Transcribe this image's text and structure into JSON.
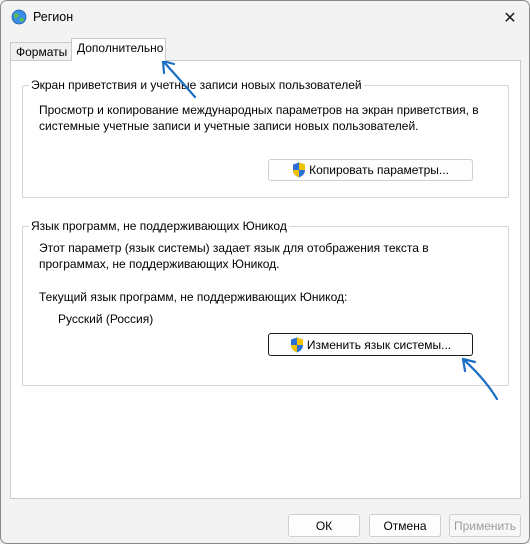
{
  "window": {
    "title": "Регион",
    "close_symbol": "✕"
  },
  "tabs": [
    {
      "label": "Форматы",
      "active": false
    },
    {
      "label": "Дополнительно",
      "active": true
    }
  ],
  "welcome_group": {
    "title": "Экран приветствия и учетные записи новых пользователей",
    "desc_line1": "Просмотр и копирование международных параметров на экран приветствия, в",
    "desc_line2": "системные учетные записи и учетные записи новых пользователей.",
    "copy_button_label": "Копировать параметры..."
  },
  "unicode_group": {
    "title": "Язык программ, не поддерживающих Юникод",
    "desc_line1": "Этот параметр (язык системы) задает язык для отображения текста в",
    "desc_line2": "программах, не поддерживающих Юникод.",
    "current_label": "Текущий язык программ, не поддерживающих Юникод:",
    "current_value": "Русский (Россия)",
    "change_button_label": "Изменить язык системы..."
  },
  "footer": {
    "ok_label": "ОК",
    "cancel_label": "Отмена",
    "apply_label": "Применить"
  },
  "colors": {
    "accent_arrow": "#1a6fc4",
    "shield_blue": "#2a6fd6",
    "shield_yellow": "#f2c200"
  },
  "icons": {
    "title": "globe-icon",
    "close": "close-icon",
    "uac": "uac-shield-icon"
  }
}
